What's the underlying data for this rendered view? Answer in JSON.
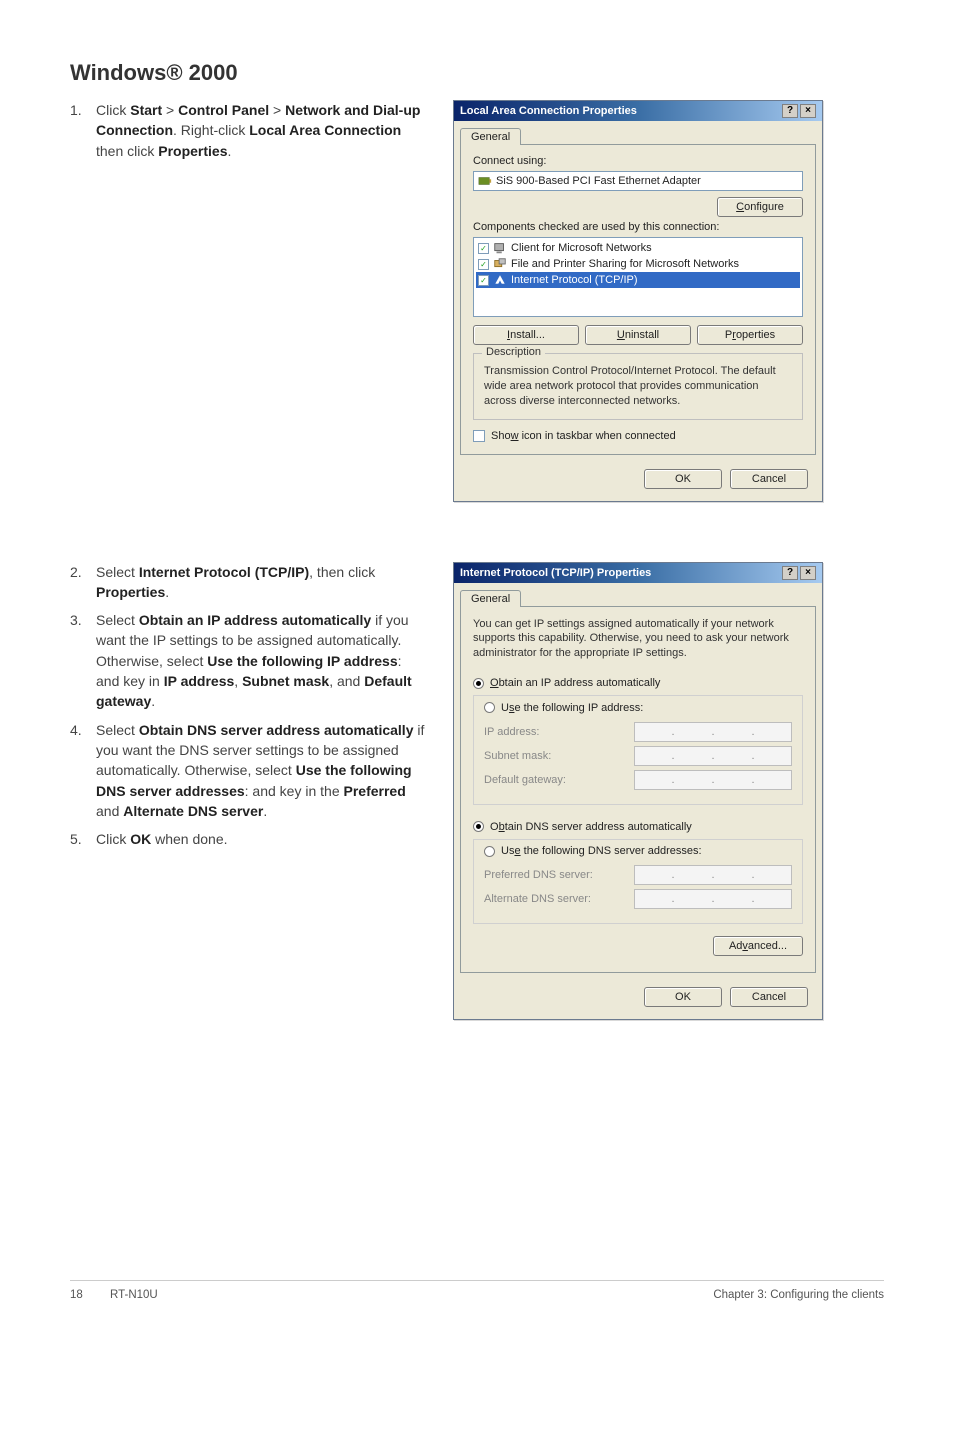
{
  "heading": "Windows® 2000",
  "step1": {
    "num": "1.",
    "pre": "Click ",
    "b1": "Start",
    "gt1": " > ",
    "b2": "Control Panel",
    "gt2": " > ",
    "b3": "Network and Dial-up Connection",
    "post1": ". Right-click ",
    "b4": "Local Area Connection",
    "post2": " then click ",
    "b5": "Properties",
    "end": "."
  },
  "dialog1": {
    "title": "Local Area Connection Properties",
    "help": "?",
    "close": "×",
    "tab": "General",
    "connect_label": "Connect using:",
    "adapter": "SiS 900-Based PCI Fast Ethernet Adapter",
    "configure": "Configure",
    "components_label": "Components checked are used by this connection:",
    "item1": "Client for Microsoft Networks",
    "item2": "File and Printer Sharing for Microsoft Networks",
    "item3": "Internet Protocol (TCP/IP)",
    "install": "Install...",
    "uninstall": "Uninstall",
    "properties": "Properties",
    "desc_legend": "Description",
    "desc_text": "Transmission Control Protocol/Internet Protocol. The default wide area network protocol that provides communication across diverse interconnected networks.",
    "show_icon": "Show icon in taskbar when connected",
    "ok": "OK",
    "cancel": "Cancel"
  },
  "step2": {
    "num": "2.",
    "pre": "Select ",
    "b1": "Internet Protocol (TCP/IP)",
    "post": ", then click ",
    "b2": "Properties",
    "end": "."
  },
  "step3": {
    "num": "3.",
    "pre": "Select ",
    "b1": "Obtain an IP address automatically",
    "post1": " if you want the IP settings to be assigned automatically. Otherwise, select ",
    "b2": "Use the following IP address",
    "post2": ": and key in ",
    "b3": "IP address",
    "c1": ", ",
    "b4": "Subnet mask",
    "c2": ", and ",
    "b5": "Default gateway",
    "end": "."
  },
  "step4": {
    "num": "4.",
    "pre": "Select ",
    "b1": "Obtain DNS server address automatically",
    "post1": " if you want the DNS server settings to be assigned automatically. Otherwise, select ",
    "b2": "Use the following DNS server addresses",
    "post2": ": and key in the ",
    "b3": "Preferred",
    "c1": " and ",
    "b4": "Alternate DNS server",
    "end": "."
  },
  "step5": {
    "num": "5.",
    "pre": "Click ",
    "b1": "OK",
    "post": " when done."
  },
  "dialog2": {
    "title": "Internet Protocol (TCP/IP) Properties",
    "help": "?",
    "close": "×",
    "tab": "General",
    "intro": "You can get IP settings assigned automatically if your network supports this capability. Otherwise, you need to ask your network administrator for the appropriate IP settings.",
    "r1": "Obtain an IP address automatically",
    "r2": "Use the following IP address:",
    "ip_label": "IP address:",
    "mask_label": "Subnet mask:",
    "gw_label": "Default gateway:",
    "r3": "Obtain DNS server address automatically",
    "r4": "Use the following DNS server addresses:",
    "pref_label": "Preferred DNS server:",
    "alt_label": "Alternate DNS server:",
    "advanced": "Advanced...",
    "ok": "OK",
    "cancel": "Cancel"
  },
  "footer": {
    "pg": "18",
    "model": "RT-N10U",
    "chapter": "Chapter 3: Configuring the clients"
  }
}
